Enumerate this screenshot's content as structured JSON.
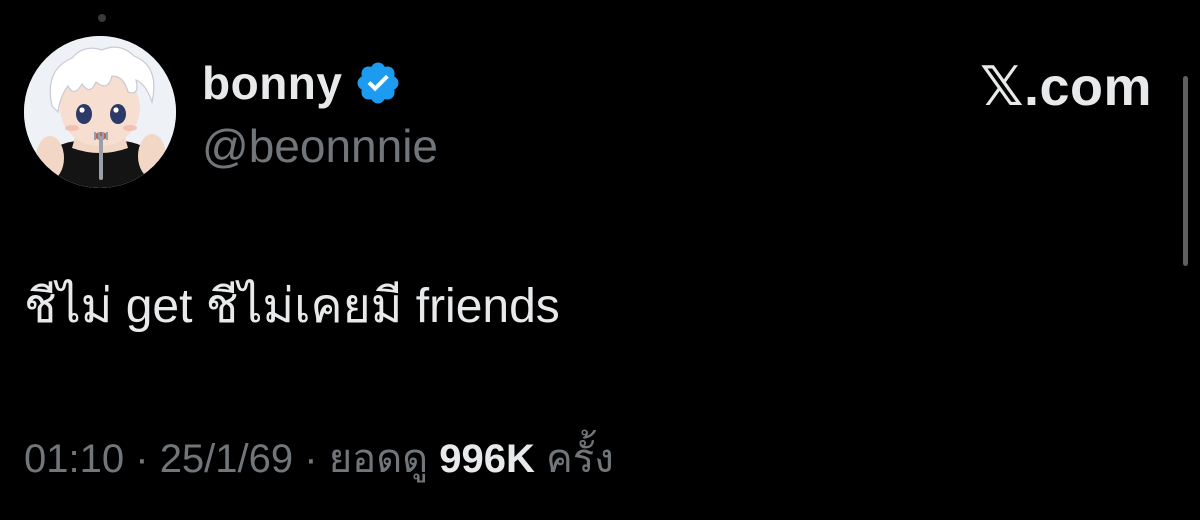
{
  "author": {
    "display_name": "bonny",
    "handle": "@beonnnie",
    "verified_icon": "verified-badge-icon",
    "avatar": "anime-character-avatar"
  },
  "brand": {
    "label": "𝕏.com"
  },
  "tweet": {
    "text": "ชีไม่ get ชีไม่เคยมี friends"
  },
  "meta": {
    "time": "01:10",
    "sep1": "·",
    "date": "25/1/69",
    "sep2": "·",
    "views_prefix": "ยอดดู",
    "views_count": "996K",
    "views_suffix": "ครั้ง"
  },
  "colors": {
    "background": "#000000",
    "primary_text": "#e7e9ea",
    "secondary_text": "#71767b",
    "verified_blue": "#1d9bf0"
  }
}
